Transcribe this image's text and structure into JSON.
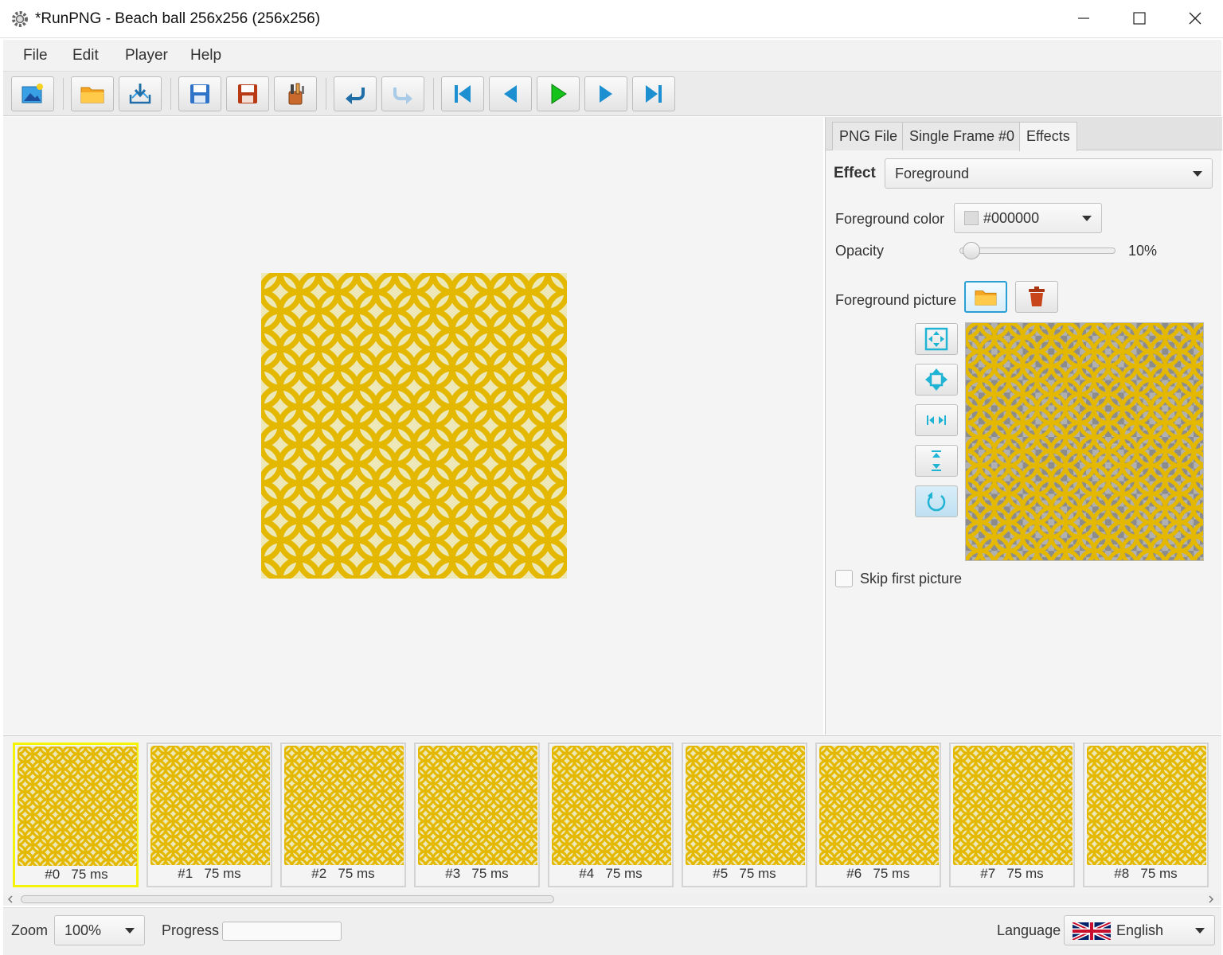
{
  "window": {
    "title": "*RunPNG - Beach ball 256x256 (256x256)",
    "icon": "gear-icon"
  },
  "menu": {
    "items": [
      "File",
      "Edit",
      "Player",
      "Help"
    ]
  },
  "toolbar": {
    "buttons": [
      "new-image-icon",
      "open-folder-icon",
      "import-icon",
      "save-icon",
      "save-as-icon",
      "tools-icon",
      "undo-icon",
      "redo-icon",
      "first-frame-icon",
      "previous-frame-icon",
      "play-icon",
      "next-frame-icon",
      "last-frame-icon"
    ]
  },
  "tabs": [
    {
      "label": "PNG File"
    },
    {
      "label": "Single Frame #0"
    },
    {
      "label": "Effects"
    }
  ],
  "effects": {
    "effect_label": "Effect",
    "effect_value": "Foreground",
    "fg_color_label": "Foreground color",
    "fg_color_value": "#000000",
    "opacity_label": "Opacity",
    "opacity_value": "10%",
    "opacity_fraction": 0.1,
    "fg_picture_label": "Foreground picture",
    "skip_first_label": "Skip first picture",
    "skip_first_checked": false,
    "align_buttons": [
      "fit-icon",
      "move-icon",
      "stretch-horizontal-icon",
      "stretch-vertical-icon",
      "rotate-icon"
    ]
  },
  "frames": [
    {
      "label": "#0",
      "duration": "75 ms",
      "selected": true
    },
    {
      "label": "#1",
      "duration": "75 ms"
    },
    {
      "label": "#2",
      "duration": "75 ms"
    },
    {
      "label": "#3",
      "duration": "75 ms"
    },
    {
      "label": "#4",
      "duration": "75 ms"
    },
    {
      "label": "#5",
      "duration": "75 ms"
    },
    {
      "label": "#6",
      "duration": "75 ms"
    },
    {
      "label": "#7",
      "duration": "75 ms"
    },
    {
      "label": "#8",
      "duration": "75 ms"
    }
  ],
  "status": {
    "zoom_label": "Zoom",
    "zoom_value": "100%",
    "progress_label": "Progress",
    "progress_value": 0,
    "language_label": "Language",
    "language_value": "English"
  },
  "colors": {
    "pattern_yellow": "#e5b800",
    "pattern_bg": "#ece8b8",
    "selection": "#f4f40a",
    "accent": "#2a9fd6"
  }
}
